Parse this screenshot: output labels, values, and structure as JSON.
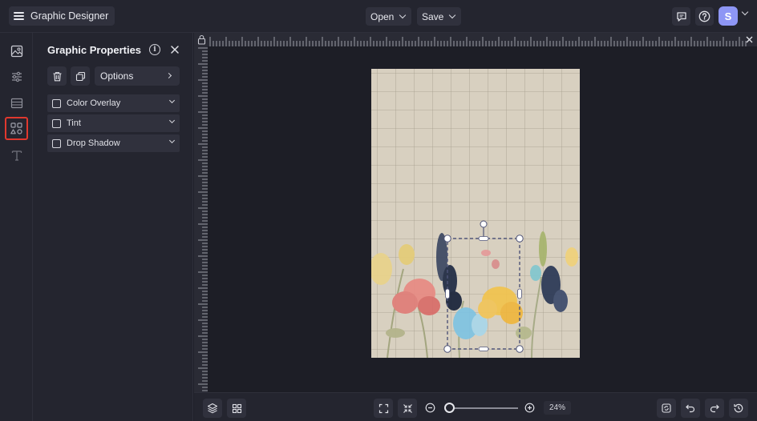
{
  "topbar": {
    "app_title": "Graphic Designer",
    "open_label": "Open",
    "save_label": "Save",
    "user_initial": "S",
    "icons": [
      "menu-icon",
      "comment-icon",
      "help-icon",
      "chevron-down-icon"
    ]
  },
  "toolrail": {
    "items": [
      "image-tool-icon",
      "adjustments-tool-icon",
      "background-tool-icon",
      "graphics-tool-icon",
      "text-tool-icon"
    ],
    "active": "graphics-tool-icon"
  },
  "panel": {
    "title": "Graphic Properties",
    "options_label": "Options",
    "accordions": [
      {
        "label": "Color Overlay",
        "checked": false
      },
      {
        "label": "Tint",
        "checked": false
      },
      {
        "label": "Drop Shadow",
        "checked": false
      }
    ]
  },
  "bottombar": {
    "zoom_label": "24%",
    "zoom_fraction": 0.0
  },
  "colors": {
    "accent_highlight": "#e0382e",
    "avatar": "#8e96f5",
    "background": "#1f2029",
    "panel": "#24252f"
  }
}
